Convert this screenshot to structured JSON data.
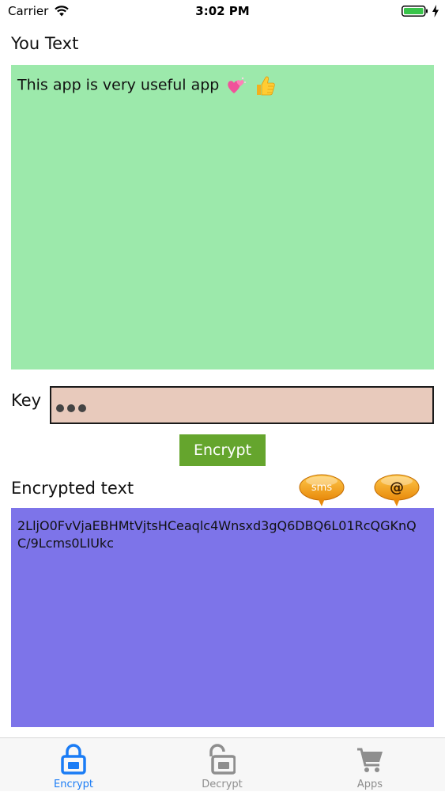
{
  "status_bar": {
    "carrier": "Carrier",
    "time": "3:02 PM"
  },
  "editor": {
    "title": "You Text",
    "text": "This app is very useful app",
    "emojis": [
      "sparkling-heart-icon",
      "thumbs-up-icon"
    ],
    "background": "#9ce9ab"
  },
  "key": {
    "label": "Key",
    "masked_length": 3,
    "background": "#e8cabc"
  },
  "encrypt_button": {
    "label": "Encrypt",
    "color": "#65a52d"
  },
  "output": {
    "title": "Encrypted text",
    "text": "2LljO0FvVjaEBHMtVjtsHCeaqlc4Wnsxd3gQ6DBQ6L01RcQGKnQC/9Lcms0LIUkc",
    "background": "#7d74e9",
    "share_sms_label": "sms",
    "share_email_label": "@"
  },
  "tabs": [
    {
      "label": "Encrypt",
      "icon": "lock-icon",
      "active": true
    },
    {
      "label": "Decrypt",
      "icon": "unlock-icon",
      "active": false
    },
    {
      "label": "Apps",
      "icon": "cart-icon",
      "active": false
    }
  ],
  "colors": {
    "tab_active": "#1a7cf5",
    "tab_inactive": "#8e8e8e"
  }
}
